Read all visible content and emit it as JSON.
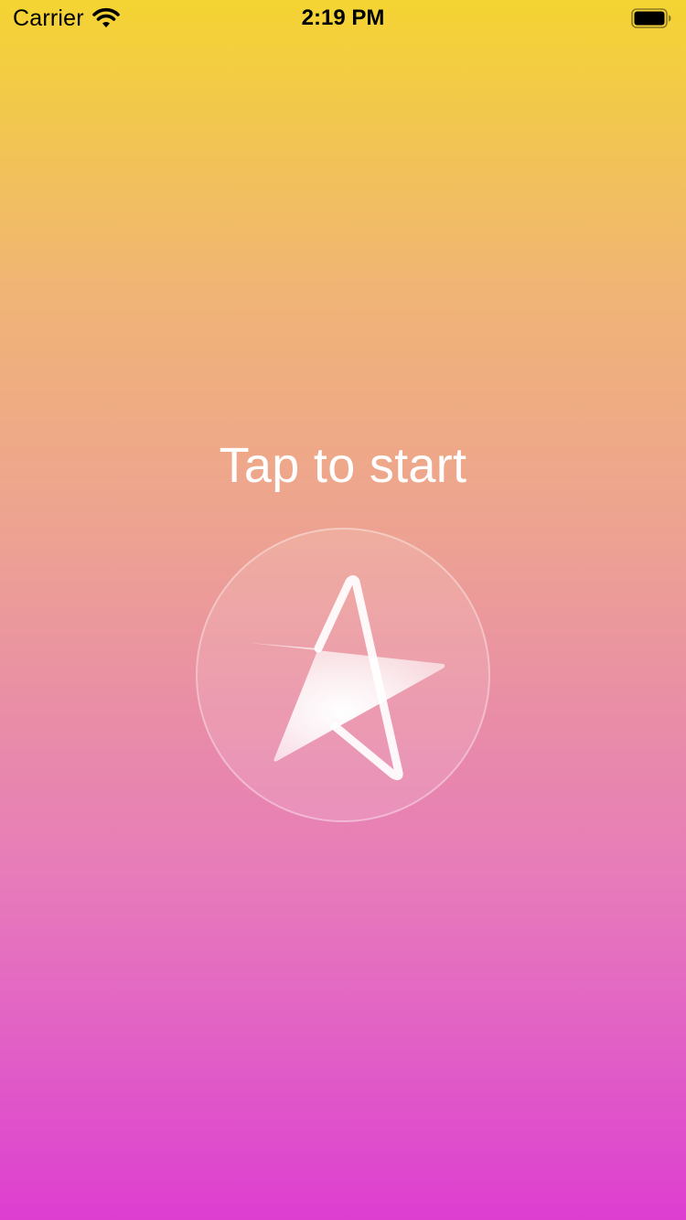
{
  "status_bar": {
    "carrier": "Carrier",
    "time": "2:19 PM",
    "wifi_icon": "wifi-icon",
    "battery_icon": "battery-icon"
  },
  "main": {
    "prompt": "Tap to start",
    "start_button_icon": "star-icon"
  },
  "colors": {
    "gradient_top": "#f4d432",
    "gradient_bottom": "#dd3ed0",
    "text": "#ffffff"
  }
}
